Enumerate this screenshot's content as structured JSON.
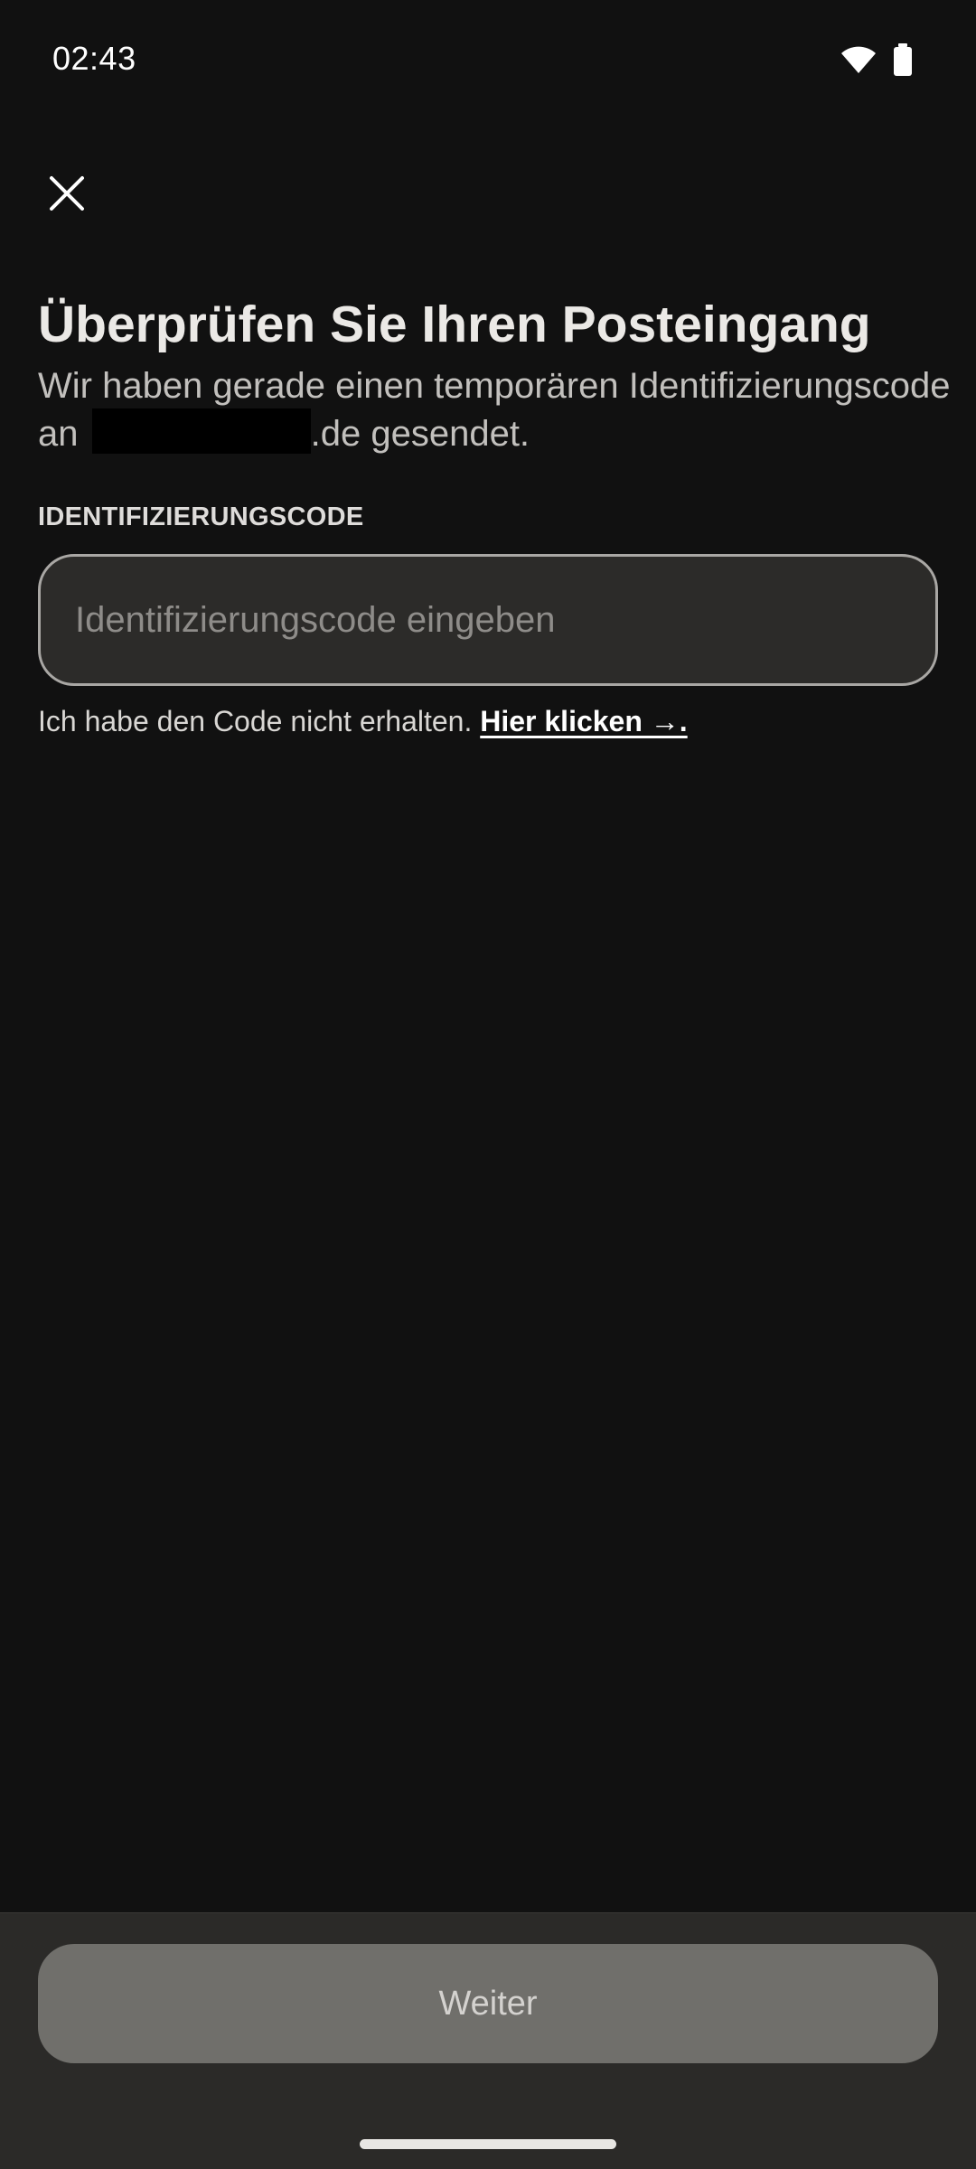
{
  "status_bar": {
    "time": "02:43",
    "icons": [
      "wifi-icon",
      "battery-icon"
    ]
  },
  "header": {
    "close_icon": "close-icon"
  },
  "content": {
    "title": "Überprüfen Sie Ihren Posteingang",
    "subtitle_part1": "Wir haben gerade einen temporären Identifizierungscode an",
    "subtitle_part2": ".de gesendet.",
    "field_label": "IDENTIFIZIERUNGSCODE",
    "input_placeholder": "Identifizierungscode eingeben",
    "input_value": "",
    "help_text": "Ich habe den Code nicht erhalten.",
    "help_link": "Hier klicken →."
  },
  "footer": {
    "continue_label": "Weiter"
  },
  "colors": {
    "background": "#111111",
    "input_background": "#2c2b29",
    "button_disabled": "#706f6b"
  }
}
